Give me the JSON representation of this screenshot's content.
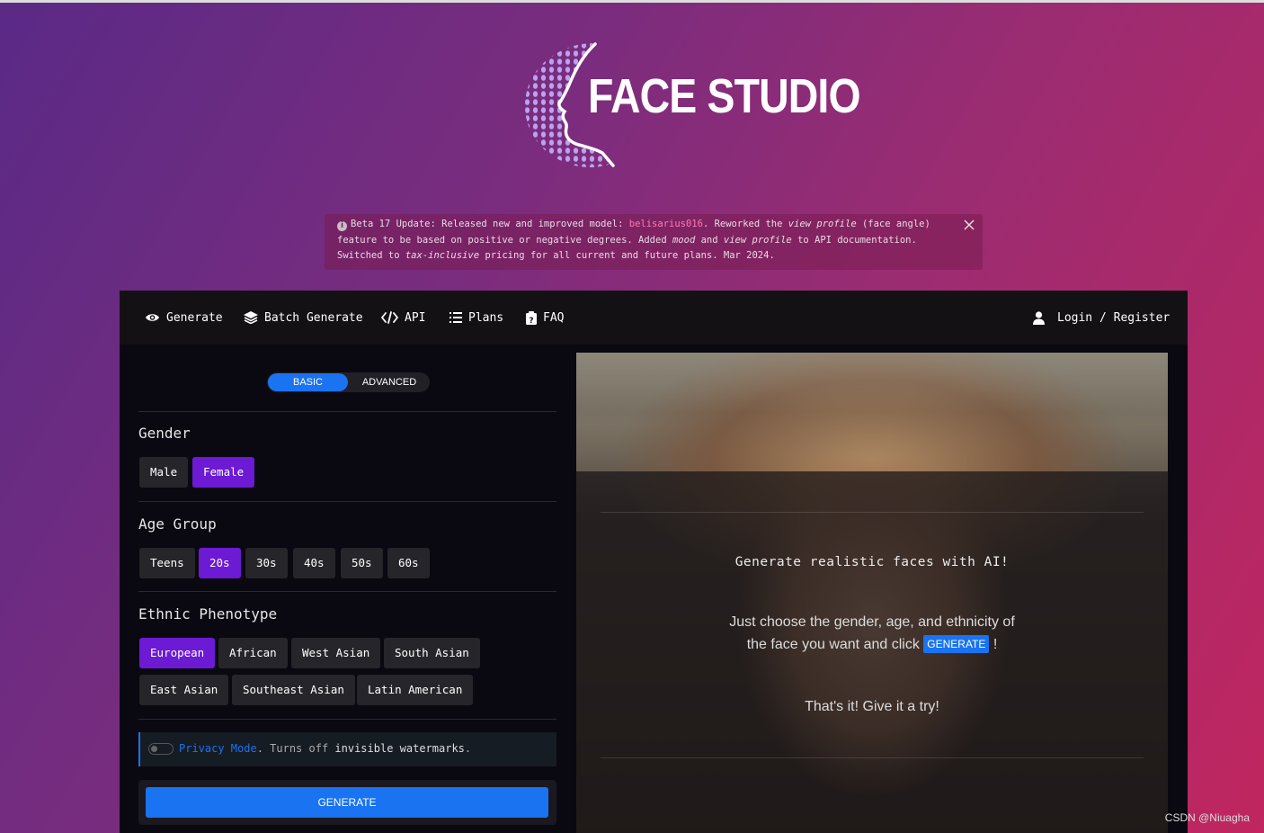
{
  "brand": {
    "name": "FACE STUDIO"
  },
  "notice": {
    "prefix": "Beta 17 Update: Released new and improved model: ",
    "model": "belisarius016",
    "part2": ". Reworked the ",
    "view_profile": "view profile",
    "part3": " (face angle) feature to be based on positive or negative degrees. Added ",
    "mood": "mood",
    "part4": " and ",
    "view_profile2": "view profile",
    "part5": " to API documentation. Switched to ",
    "tax": "tax-inclusive",
    "part6": " pricing for all current and future plans. Mar 2024."
  },
  "nav": {
    "generate": "Generate",
    "batch": "Batch Generate",
    "api": "API",
    "plans": "Plans",
    "faq": "FAQ",
    "login": "Login / Register"
  },
  "mode": {
    "basic": "BASIC",
    "advanced": "ADVANCED",
    "selected": "BASIC"
  },
  "gender": {
    "title": "Gender",
    "options": [
      "Male",
      "Female"
    ],
    "selected": "Female"
  },
  "age": {
    "title": "Age Group",
    "options": [
      "Teens",
      "20s",
      "30s",
      "40s",
      "50s",
      "60s"
    ],
    "selected": "20s"
  },
  "ethnic": {
    "title": "Ethnic Phenotype",
    "options": [
      "European",
      "African",
      "West Asian",
      "South Asian",
      "East Asian",
      "Southeast Asian",
      "Latin American"
    ],
    "selected": "European"
  },
  "privacy": {
    "label": "Privacy Mode",
    "text1": ". Turns off ",
    "text2": "invisible watermarks",
    "text3": "."
  },
  "generate_button": "GENERATE",
  "preview": {
    "title": "Generate realistic faces with AI!",
    "line1": "Just choose the gender, age, and ethnicity of",
    "line2a": "the face you want and click ",
    "badge": "GENERATE",
    "line2b": " !",
    "line3": "That's it! Give it a try!"
  },
  "watermark": "CSDN @Niuagha",
  "colors": {
    "accent": "#1a73f0",
    "selected": "#6c1ad4",
    "model_highlight": "#ff7bb6"
  }
}
